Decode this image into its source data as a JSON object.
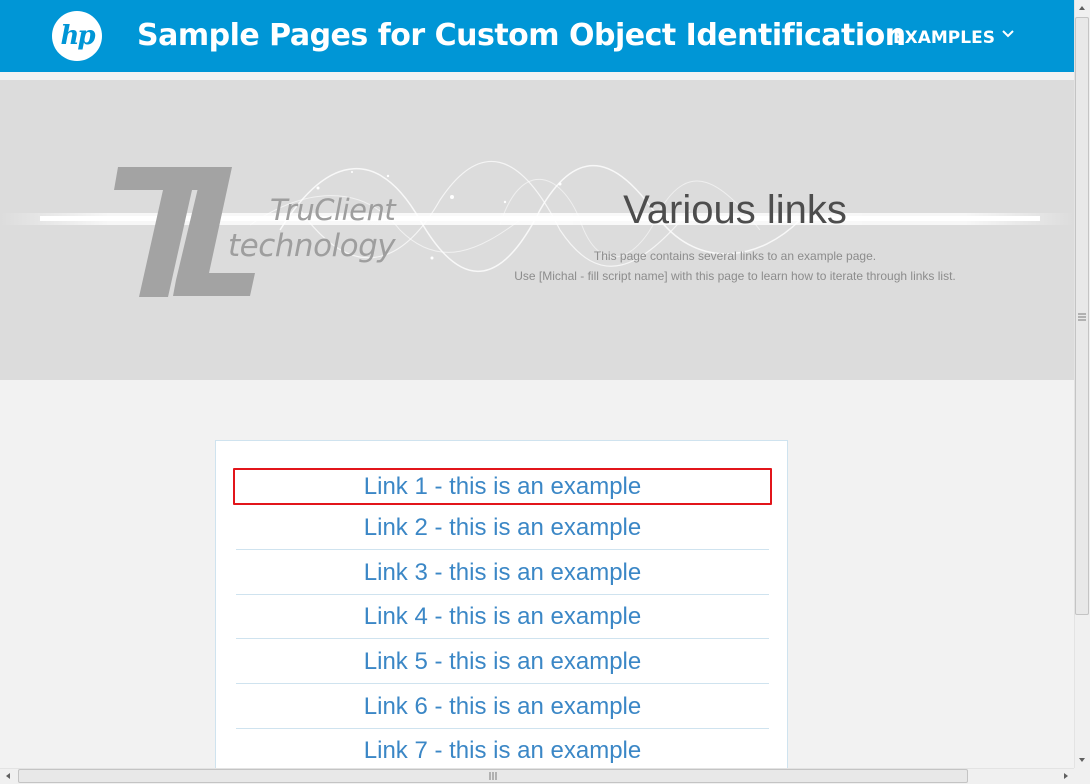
{
  "header": {
    "logo_text": "hp",
    "title": "Sample Pages for Custom Object Identification",
    "nav_examples": "EXAMPLES"
  },
  "banner": {
    "brand_line1": "TruClient",
    "brand_line2": "technology",
    "page_title": "Various links",
    "description_line1": "This page contains several links to an example page.",
    "description_line2": "Use [Michal - fill script name] with this page to learn how to iterate through links list."
  },
  "links": [
    "Link 1 - this is an example",
    "Link 2 - this is an example",
    "Link 3 - this is an example",
    "Link 4 - this is an example",
    "Link 5 - this is an example",
    "Link 6 - this is an example",
    "Link 7 - this is an example"
  ],
  "colors": {
    "header_bg": "#0096d6",
    "link": "#3b87c6",
    "highlight_border": "#e2151b"
  }
}
